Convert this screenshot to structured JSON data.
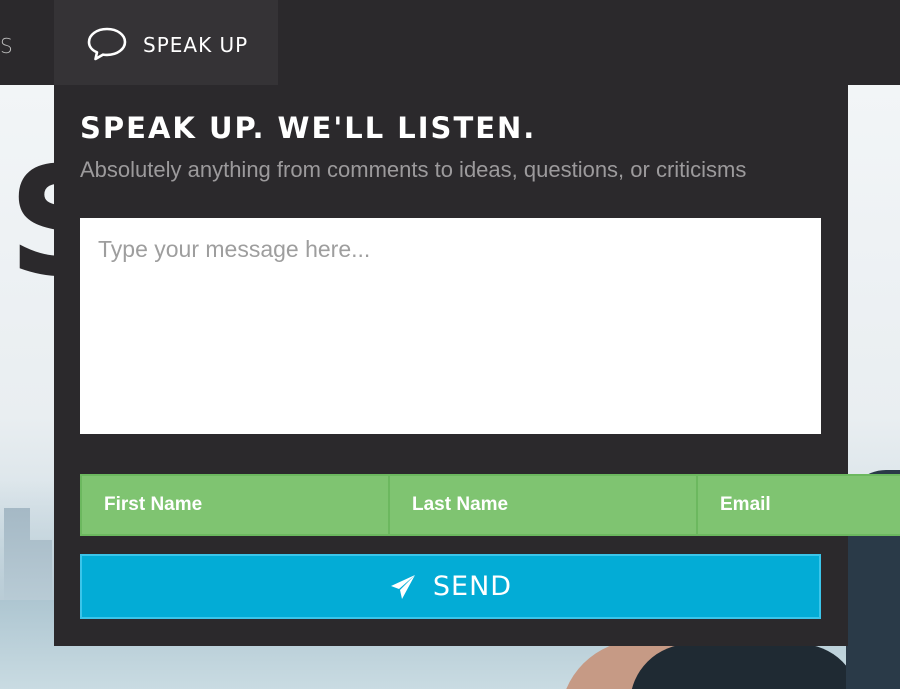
{
  "nav": {
    "prev_item_fragment": "S",
    "active_tab": {
      "label": "SPEAK UP",
      "icon": "speech-bubble-icon"
    }
  },
  "background": {
    "headline_fragment": "S"
  },
  "feedback": {
    "title": "SPEAK UP. WE'LL LISTEN.",
    "subtitle": "Absolutely anything from comments to ideas, questions, or criticisms",
    "message_placeholder": "Type your message here...",
    "first_name_placeholder": "First Name",
    "last_name_placeholder": "Last Name",
    "email_placeholder": "Email",
    "send_label": "SEND",
    "send_icon": "paper-plane-icon"
  },
  "colors": {
    "dark_panel": "#2b292c",
    "field_green": "#7fc471",
    "send_blue": "#03acd6"
  }
}
